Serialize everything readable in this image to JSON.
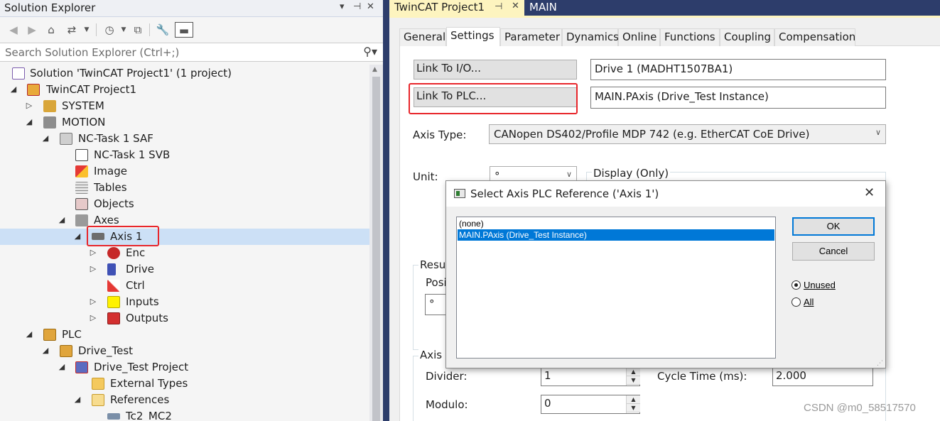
{
  "solution_explorer": {
    "title": "Solution Explorer",
    "title_controls": [
      "▾",
      "⊣",
      "✕"
    ],
    "search_placeholder": "Search Solution Explorer (Ctrl+;)",
    "toolbar_icons": [
      "back-icon",
      "forward-icon",
      "home-icon",
      "sync-icon",
      "history-icon",
      "collapse-icon",
      "properties-icon",
      "preview-icon"
    ],
    "tree": [
      {
        "label": "Solution 'TwinCAT Project1' (1 project)",
        "icon": "solution-icon"
      },
      {
        "label": "TwinCAT Project1",
        "icon": "project-icon"
      },
      {
        "label": "SYSTEM",
        "icon": "system-icon"
      },
      {
        "label": "MOTION",
        "icon": "motion-icon"
      },
      {
        "label": "NC-Task 1 SAF",
        "icon": "nc-task-icon"
      },
      {
        "label": "NC-Task 1 SVB",
        "icon": "nc-svb-icon"
      },
      {
        "label": "Image",
        "icon": "image-icon"
      },
      {
        "label": "Tables",
        "icon": "tables-icon"
      },
      {
        "label": "Objects",
        "icon": "objects-icon"
      },
      {
        "label": "Axes",
        "icon": "axes-icon"
      },
      {
        "label": "Axis 1",
        "icon": "axis-icon"
      },
      {
        "label": "Enc",
        "icon": "encoder-icon"
      },
      {
        "label": "Drive",
        "icon": "drive-icon"
      },
      {
        "label": "Ctrl",
        "icon": "ctrl-icon"
      },
      {
        "label": "Inputs",
        "icon": "inputs-icon"
      },
      {
        "label": "Outputs",
        "icon": "outputs-icon"
      },
      {
        "label": "PLC",
        "icon": "plc-icon"
      },
      {
        "label": "Drive_Test",
        "icon": "plc-project-icon"
      },
      {
        "label": "Drive_Test Project",
        "icon": "plc-subproject-icon"
      },
      {
        "label": "External Types",
        "icon": "folder-icon"
      },
      {
        "label": "References",
        "icon": "folder-open-icon"
      },
      {
        "label": "Tc2_MC2",
        "icon": "reference-icon"
      }
    ]
  },
  "document_tabs": [
    {
      "label": "TwinCAT Project1",
      "pin": "⊣",
      "close": "✕"
    },
    {
      "label": "MAIN"
    }
  ],
  "property_tabs": [
    "General",
    "Settings",
    "Parameter",
    "Dynamics",
    "Online",
    "Functions",
    "Coupling",
    "Compensation"
  ],
  "settings": {
    "link_io_button": "Link To I/O...",
    "link_io_value": "Drive 1 (MADHT1507BA1)",
    "link_plc_button": "Link To PLC...",
    "link_plc_value": "MAIN.PAxis (Drive_Test Instance)",
    "axis_type_label": "Axis Type:",
    "axis_type_value": "CANopen DS402/Profile MDP 742 (e.g. EtherCAT CoE Drive)",
    "unit_label": "Unit:",
    "unit_value": "°",
    "display_label": "Display (Only)",
    "result_group_label": "Resul",
    "position_label": "Posi",
    "position_value": "°",
    "axis_group_label": "Axis C",
    "divider_label": "Divider:",
    "divider_value": "1",
    "cycle_time_label": "Cycle Time (ms):",
    "cycle_time_value": "2.000",
    "modulo_label": "Modulo:",
    "modulo_value": "0"
  },
  "dialog": {
    "title": "Select Axis PLC Reference ('Axis 1')",
    "close": "✕",
    "items": [
      "(none)",
      "MAIN.PAxis (Drive_Test Instance)"
    ],
    "selected_index": 1,
    "ok_label": "OK",
    "cancel_label": "Cancel",
    "radio_unused": "Unused",
    "radio_all": "All",
    "radio_selected": "Unused"
  },
  "watermark": "CSDN @m0_58517570",
  "colors": {
    "selection": "#0078d7",
    "tree_selection": "#cce0f6",
    "highlight_box": "#e8262b",
    "tab_strip": "#2d3d6b",
    "active_doc_tab": "#fdf4bf"
  }
}
